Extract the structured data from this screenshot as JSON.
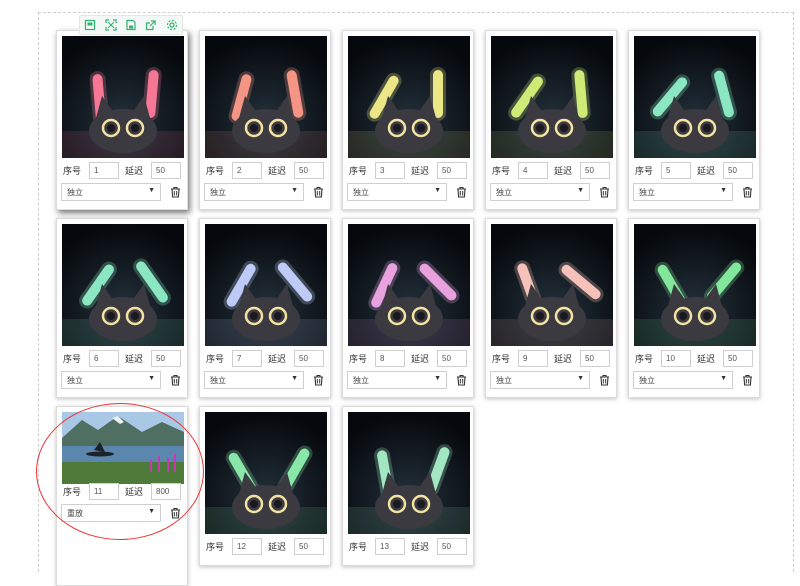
{
  "toolbar": {
    "icons": [
      "save-frame-icon",
      "fullscreen-icon",
      "save-icon",
      "export-icon",
      "settings-icon"
    ],
    "accent": "#2fb36e"
  },
  "labels": {
    "seq": "序号",
    "delay": "延迟"
  },
  "frames": [
    {
      "seq": "1",
      "delay": "50",
      "mode": "独立",
      "image": "cat-glowsticks",
      "bar": "#ff7b9a"
    },
    {
      "seq": "2",
      "delay": "50",
      "mode": "独立",
      "image": "cat-glowsticks",
      "bar": "#ff9a8a"
    },
    {
      "seq": "3",
      "delay": "50",
      "mode": "独立",
      "image": "cat-glowsticks",
      "bar": "#f5f08a"
    },
    {
      "seq": "4",
      "delay": "50",
      "mode": "独立",
      "image": "cat-glowsticks",
      "bar": "#d8f27a"
    },
    {
      "seq": "5",
      "delay": "50",
      "mode": "独立",
      "image": "cat-glowsticks",
      "bar": "#8ff0c8"
    },
    {
      "seq": "6",
      "delay": "50",
      "mode": "独立",
      "image": "cat-glowsticks",
      "bar": "#8ff0c8"
    },
    {
      "seq": "7",
      "delay": "50",
      "mode": "独立",
      "image": "cat-glowsticks",
      "bar": "#c6d2ff"
    },
    {
      "seq": "8",
      "delay": "50",
      "mode": "独立",
      "image": "cat-glowsticks",
      "bar": "#f0a8e6"
    },
    {
      "seq": "9",
      "delay": "50",
      "mode": "独立",
      "image": "cat-glowsticks",
      "bar": "#ffc8c0"
    },
    {
      "seq": "10",
      "delay": "50",
      "mode": "独立",
      "image": "cat-glowsticks",
      "bar": "#86f0a0"
    },
    {
      "seq": "11",
      "delay": "800",
      "mode": "重放",
      "image": "lake-landscape",
      "bar": ""
    },
    {
      "seq": "12",
      "delay": "50",
      "mode": "",
      "image": "cat-glowsticks",
      "bar": "#8ff0b0"
    },
    {
      "seq": "13",
      "delay": "50",
      "mode": "",
      "image": "cat-glowsticks",
      "bar": "#a8f0c8"
    }
  ]
}
